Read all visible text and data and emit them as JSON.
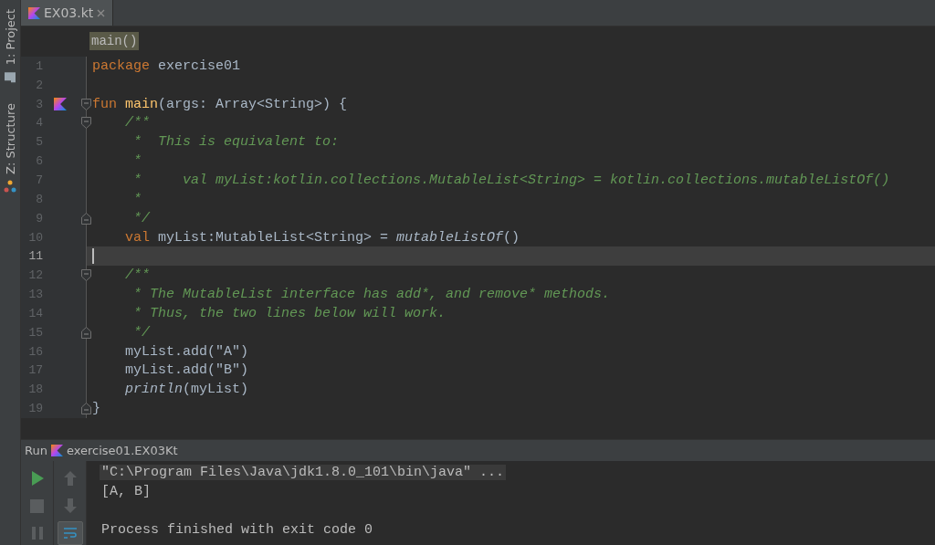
{
  "tool_strip": [
    {
      "label": "1: Project",
      "kind": "project",
      "selected": false
    },
    {
      "label": "Z: Structure",
      "kind": "structure",
      "selected": false
    }
  ],
  "tabs": [
    {
      "label": "EX03.kt",
      "selected": true
    }
  ],
  "breadcrumb": "main()",
  "editor": {
    "lines": [
      {
        "number": "1",
        "current": false,
        "run_marker": false,
        "fold_start": false,
        "fold_end": false,
        "tokens": [
          {
            "kind": "keyword",
            "text": "package"
          },
          {
            "kind": "plain",
            "text": " exercise01"
          }
        ]
      },
      {
        "number": "2",
        "current": false,
        "run_marker": false,
        "fold_start": false,
        "fold_end": false
      },
      {
        "number": "3",
        "current": false,
        "run_marker": true,
        "fold_start": true,
        "fold_end": false,
        "tokens": [
          {
            "kind": "keyword",
            "text": "fun "
          },
          {
            "kind": "function",
            "text": "main"
          },
          {
            "kind": "plain",
            "text": "(args: Array<String>) {"
          }
        ]
      },
      {
        "number": "4",
        "current": false,
        "run_marker": false,
        "fold_start": true,
        "fold_end": false,
        "tokens": [
          {
            "kind": "comment",
            "text": "    /**"
          }
        ]
      },
      {
        "number": "5",
        "current": false,
        "run_marker": false,
        "fold_start": false,
        "fold_end": false,
        "tokens": [
          {
            "kind": "comment",
            "text": "     *  This is equivalent to:"
          }
        ]
      },
      {
        "number": "6",
        "current": false,
        "run_marker": false,
        "fold_start": false,
        "fold_end": false,
        "tokens": [
          {
            "kind": "comment",
            "text": "     *"
          }
        ]
      },
      {
        "number": "7",
        "current": false,
        "run_marker": false,
        "fold_start": false,
        "fold_end": false,
        "tokens": [
          {
            "kind": "comment",
            "text": "     *     val myList:kotlin.collections.MutableList<String> = kotlin.collections.mutableListOf()"
          }
        ]
      },
      {
        "number": "8",
        "current": false,
        "run_marker": false,
        "fold_start": false,
        "fold_end": false,
        "tokens": [
          {
            "kind": "comment",
            "text": "     *"
          }
        ]
      },
      {
        "number": "9",
        "current": false,
        "run_marker": false,
        "fold_start": false,
        "fold_end": true,
        "tokens": [
          {
            "kind": "comment",
            "text": "     */"
          }
        ]
      },
      {
        "number": "10",
        "current": false,
        "run_marker": false,
        "fold_start": false,
        "fold_end": false,
        "tokens": [
          {
            "kind": "keyword",
            "text": "    val"
          },
          {
            "kind": "plain",
            "text": " myList:MutableList<String> = "
          },
          {
            "kind": "call",
            "text": "mutableListOf"
          },
          {
            "kind": "plain",
            "text": "()"
          }
        ]
      },
      {
        "number": "11",
        "current": true,
        "run_marker": false,
        "fold_start": false,
        "fold_end": false
      },
      {
        "number": "12",
        "current": false,
        "run_marker": false,
        "fold_start": true,
        "fold_end": false,
        "tokens": [
          {
            "kind": "comment",
            "text": "    /**"
          }
        ]
      },
      {
        "number": "13",
        "current": false,
        "run_marker": false,
        "fold_start": false,
        "fold_end": false,
        "tokens": [
          {
            "kind": "comment",
            "text": "     * The MutableList interface has add*, and remove* methods."
          }
        ]
      },
      {
        "number": "14",
        "current": false,
        "run_marker": false,
        "fold_start": false,
        "fold_end": false,
        "tokens": [
          {
            "kind": "comment",
            "text": "     * Thus, the two lines below will work."
          }
        ]
      },
      {
        "number": "15",
        "current": false,
        "run_marker": false,
        "fold_start": false,
        "fold_end": true,
        "tokens": [
          {
            "kind": "comment",
            "text": "     */"
          }
        ]
      },
      {
        "number": "16",
        "current": false,
        "run_marker": false,
        "fold_start": false,
        "fold_end": false,
        "tokens": [
          {
            "kind": "plain",
            "text": "    myList.add(\"A\")"
          }
        ]
      },
      {
        "number": "17",
        "current": false,
        "run_marker": false,
        "fold_start": false,
        "fold_end": false,
        "tokens": [
          {
            "kind": "plain",
            "text": "    myList.add(\"B\")"
          }
        ]
      },
      {
        "number": "18",
        "current": false,
        "run_marker": false,
        "fold_start": false,
        "fold_end": false,
        "tokens": [
          {
            "kind": "call",
            "text": "    println"
          },
          {
            "kind": "plain",
            "text": "(myList)"
          }
        ]
      },
      {
        "number": "19",
        "current": false,
        "run_marker": false,
        "fold_start": false,
        "fold_end": true,
        "tokens": [
          {
            "kind": "plain",
            "text": "}"
          }
        ]
      }
    ]
  },
  "run_panel": {
    "label": "Run",
    "config": "exercise01.EX03Kt",
    "console": [
      {
        "text": "\"C:\\Program Files\\Java\\jdk1.8.0_101\\bin\\java\" ...",
        "kind": "command"
      },
      {
        "text": "[A, B]",
        "kind": "output"
      },
      {
        "kind": "blank"
      },
      {
        "text": "Process finished with exit code 0",
        "kind": "output"
      }
    ]
  }
}
